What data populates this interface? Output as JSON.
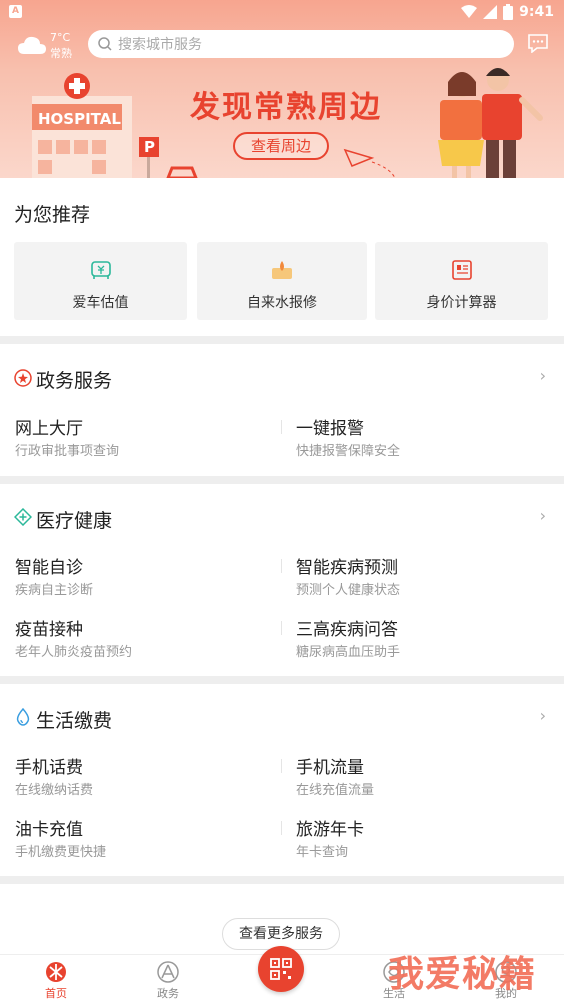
{
  "status_bar": {
    "time": "9:41",
    "sim_letter": "A"
  },
  "header": {
    "weather_temp": "7°C",
    "weather_city": "常熟",
    "search_placeholder": "搜索城市服务"
  },
  "banner": {
    "title": "发现常熟周边",
    "button": "查看周边",
    "hospital_sign": "HOSPITAL",
    "parking_sign": "P"
  },
  "recommend": {
    "title": "为您推荐",
    "items": [
      {
        "label": "爱车估值",
        "icon": "car-value-icon"
      },
      {
        "label": "自来水报修",
        "icon": "water-repair-icon"
      },
      {
        "label": "身价计算器",
        "icon": "net-worth-calculator-icon"
      }
    ]
  },
  "sections": [
    {
      "title": "政务服务",
      "icon": "gov-star-icon",
      "items": [
        {
          "name": "网上大厅",
          "desc": "行政审批事项查询"
        },
        {
          "name": "一键报警",
          "desc": "快捷报警保障安全"
        }
      ]
    },
    {
      "title": "医疗健康",
      "icon": "medical-cross-icon",
      "items": [
        {
          "name": "智能自诊",
          "desc": "疾病自主诊断"
        },
        {
          "name": "智能疾病预测",
          "desc": "预测个人健康状态"
        },
        {
          "name": "疫苗接种",
          "desc": "老年人肺炎疫苗预约"
        },
        {
          "name": "三高疾病问答",
          "desc": "糖尿病高血压助手"
        }
      ]
    },
    {
      "title": "生活缴费",
      "icon": "water-drop-icon",
      "items": [
        {
          "name": "手机话费",
          "desc": "在线缴纳话费"
        },
        {
          "name": "手机流量",
          "desc": "在线充值流量"
        },
        {
          "name": "油卡充值",
          "desc": "手机缴费更快捷"
        },
        {
          "name": "旅游年卡",
          "desc": "年卡查询"
        }
      ]
    }
  ],
  "more_button": "查看更多服务",
  "nav": {
    "tabs": [
      {
        "label": "首页",
        "icon": "home-icon",
        "active": true
      },
      {
        "label": "政务",
        "icon": "gov-icon",
        "active": false
      },
      {
        "label": "生活",
        "icon": "life-icon",
        "active": false
      },
      {
        "label": "我的",
        "icon": "profile-icon",
        "active": false
      }
    ],
    "center_icon": "qr-scan-icon"
  },
  "watermark": "我爱秘籍",
  "colors": {
    "accent": "#e8432f",
    "header_gradient_top": "#f7a58f",
    "header_gradient_bottom": "#fbd7cb"
  }
}
